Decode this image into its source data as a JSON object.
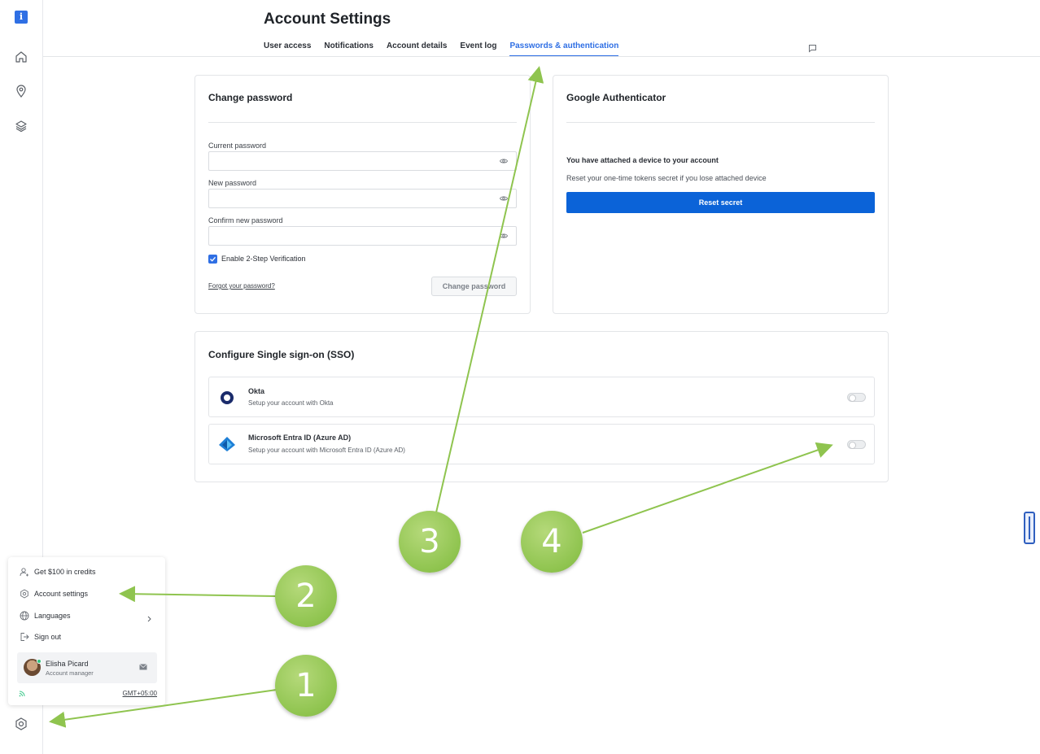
{
  "rail": {
    "logo_glyph": "i",
    "icons": [
      "home-icon",
      "location-pin-icon",
      "layers-icon"
    ],
    "bottom_icon": "gear-icon"
  },
  "header": {
    "title": "Account Settings",
    "tabs": [
      {
        "label": "User access",
        "active": false
      },
      {
        "label": "Notifications",
        "active": false
      },
      {
        "label": "Account details",
        "active": false
      },
      {
        "label": "Event log",
        "active": false
      },
      {
        "label": "Passwords & authentication",
        "active": true
      }
    ]
  },
  "change_password": {
    "title": "Change password",
    "current_label": "Current password",
    "current_value": "",
    "new_label": "New password",
    "new_value": "",
    "confirm_label": "Confirm new password",
    "confirm_value": "",
    "two_step_label": "Enable 2-Step Verification",
    "two_step_checked": true,
    "forgot_link": "Forgot your password?",
    "submit_label": "Change password"
  },
  "google_auth": {
    "title": "Google Authenticator",
    "status": "You have attached a device to your account",
    "hint": "Reset your one-time tokens secret if you lose attached device",
    "reset_label": "Reset secret"
  },
  "sso": {
    "title": "Configure Single sign-on (SSO)",
    "providers": [
      {
        "name": "Okta",
        "description": "Setup your account with Okta",
        "enabled": false
      },
      {
        "name": "Microsoft Entra ID (Azure AD)",
        "description": "Setup your account with Microsoft Entra ID (Azure AD)",
        "enabled": false
      }
    ]
  },
  "user_menu": {
    "items": [
      {
        "label": "Get $100 in credits",
        "icon": "add-user-icon"
      },
      {
        "label": "Account settings",
        "icon": "gear-icon"
      },
      {
        "label": "Languages",
        "icon": "globe-icon"
      },
      {
        "label": "Sign out",
        "icon": "sign-out-icon"
      }
    ],
    "user": {
      "name": "Elisha Picard",
      "role": "Account manager"
    },
    "timezone": "GMT+05:00"
  },
  "annotations": [
    "1",
    "2",
    "3",
    "4"
  ],
  "colors": {
    "accent": "#2f6fe4",
    "primary_button": "#0b63d8",
    "annotation": "#8fc44f"
  }
}
